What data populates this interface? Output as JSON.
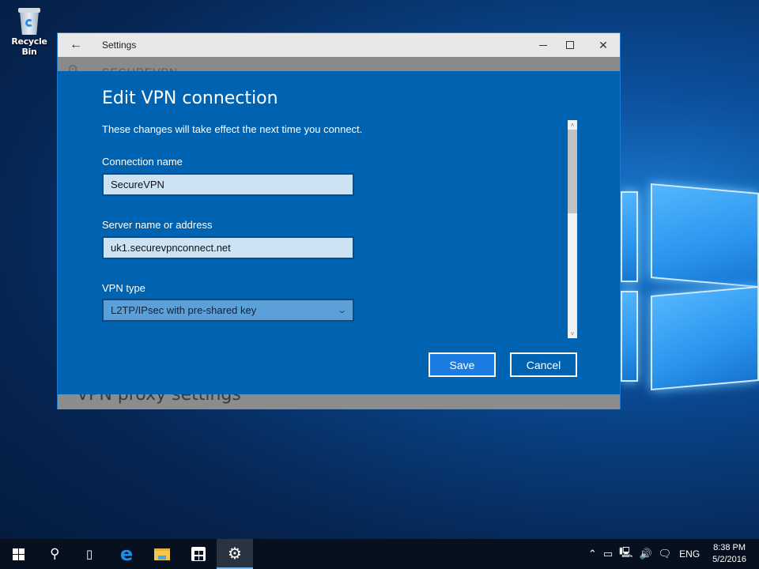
{
  "desktop": {
    "icons": [
      {
        "label": "Recycle Bin",
        "icon": "recycle-bin-icon"
      }
    ]
  },
  "window": {
    "title": "Settings",
    "back_icon": "back-arrow-icon",
    "controls": {
      "minimize": "minimize-icon",
      "maximize": "maximize-icon",
      "close": "close-icon",
      "close_glyph": "✕"
    },
    "behind": {
      "header_title": "SECUREVPN",
      "footer_heading": "VPN proxy settings"
    }
  },
  "dialog": {
    "title": "Edit VPN connection",
    "subtitle": "These changes will take effect the next time you connect.",
    "fields": {
      "connection_name": {
        "label": "Connection name",
        "value": "SecureVPN"
      },
      "server": {
        "label": "Server name or address",
        "value": "uk1.securevpnconnect.net"
      },
      "vpn_type": {
        "label": "VPN type",
        "selected": "L2TP/IPsec with pre-shared key"
      }
    },
    "buttons": {
      "save": "Save",
      "cancel": "Cancel"
    },
    "scroll_position": 0
  },
  "taskbar": {
    "items": [
      {
        "name": "start",
        "icon": "windows-logo-icon"
      },
      {
        "name": "search",
        "icon": "search-icon"
      },
      {
        "name": "task-view",
        "icon": "task-view-icon"
      },
      {
        "name": "edge",
        "icon": "edge-icon"
      },
      {
        "name": "file-explorer",
        "icon": "folder-icon"
      },
      {
        "name": "store",
        "icon": "store-icon"
      },
      {
        "name": "settings",
        "icon": "gear-icon",
        "active": true
      }
    ],
    "tray": {
      "language": "ENG",
      "time": "8:38 PM",
      "date": "5/2/2016"
    }
  },
  "colors": {
    "accent": "#0063b1",
    "save_button": "#1a7ce0",
    "input_background": "#cde3f4"
  }
}
